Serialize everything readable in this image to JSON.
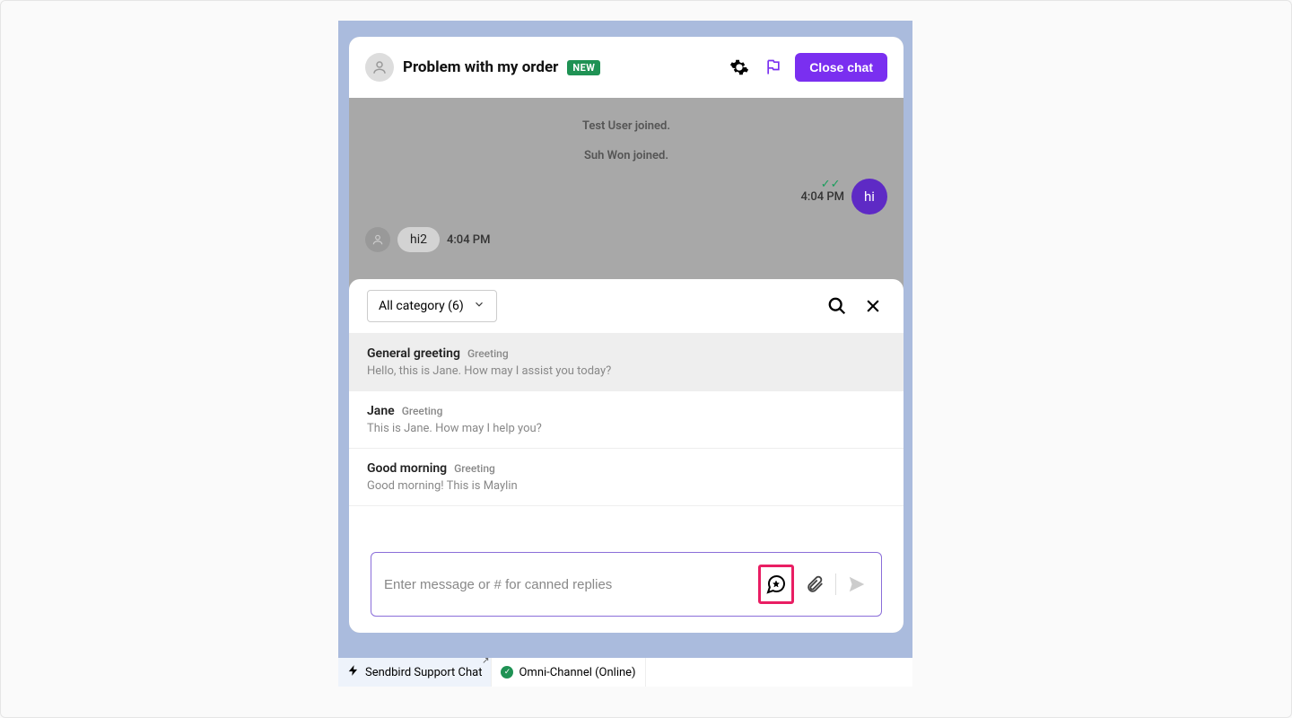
{
  "header": {
    "title": "Problem with my order",
    "badge": "NEW",
    "close_label": "Close chat"
  },
  "system_messages": [
    "Test User joined.",
    "Suh Won joined."
  ],
  "messages": {
    "outgoing": {
      "text": "hi",
      "time": "4:04 PM"
    },
    "incoming": {
      "text": "hi2",
      "time": "4:04 PM"
    }
  },
  "canned": {
    "category_label": "All category (6)",
    "items": [
      {
        "name": "General greeting",
        "category": "Greeting",
        "preview": "Hello, this is Jane. How may I assist you today?"
      },
      {
        "name": "Jane",
        "category": "Greeting",
        "preview": "This is Jane. How may I help you?"
      },
      {
        "name": "Good morning",
        "category": "Greeting",
        "preview": "Good morning! This is Maylin"
      }
    ]
  },
  "input": {
    "placeholder": "Enter message or # for canned replies"
  },
  "footer": {
    "item1": "Sendbird Support Chat",
    "item2": "Omni-Channel (Online)"
  }
}
